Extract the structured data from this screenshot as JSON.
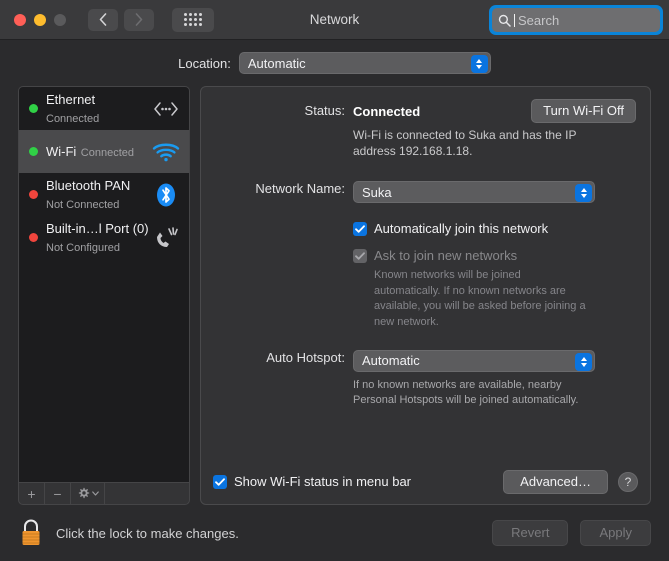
{
  "window": {
    "title": "Network",
    "traffic_lights": [
      "close",
      "minimize",
      "zoom"
    ]
  },
  "toolbar": {
    "back_label": "‹",
    "forward_label": "›",
    "grid_name": "show-all-preferences",
    "search": {
      "placeholder": "Search",
      "value": "",
      "focused": true
    }
  },
  "location": {
    "label": "Location:",
    "value": "Automatic"
  },
  "sidebar": {
    "interfaces": [
      {
        "name": "Ethernet",
        "status": "Connected",
        "dot": "green",
        "icon": "ethernet-icon",
        "selected": false
      },
      {
        "name": "Wi-Fi",
        "status": "Connected",
        "dot": "green",
        "icon": "wifi-icon",
        "selected": true
      },
      {
        "name": "Bluetooth PAN",
        "status": "Not Connected",
        "dot": "red",
        "icon": "bluetooth-icon",
        "selected": false
      },
      {
        "name": "Built-in…l Port (0)",
        "status": "Not Configured",
        "dot": "red",
        "icon": "modem-icon",
        "selected": false
      }
    ],
    "toolbar": {
      "add_label": "+",
      "remove_label": "−",
      "gear_label": "gear-icon"
    }
  },
  "main": {
    "status": {
      "label": "Status:",
      "value": "Connected",
      "description": "Wi-Fi is connected to Suka and has the IP address 192.168.1.18.",
      "toggle_button": "Turn Wi-Fi Off"
    },
    "network_name": {
      "label": "Network Name:",
      "value": "Suka"
    },
    "auto_join": {
      "label": "Automatically join this network",
      "checked": true,
      "enabled": true
    },
    "ask_join": {
      "label": "Ask to join new networks",
      "checked": true,
      "enabled": false,
      "note": "Known networks will be joined automatically. If no known networks are available, you will be asked before joining a new network."
    },
    "auto_hotspot": {
      "label": "Auto Hotspot:",
      "value": "Automatic",
      "note": "If no known networks are available, nearby Personal Hotspots will be joined automatically."
    },
    "menu_bar": {
      "label": "Show Wi-Fi status in menu bar",
      "checked": true
    },
    "advanced_button": "Advanced…",
    "help_button": "?"
  },
  "bottom": {
    "lock_text": "Click the lock to make changes.",
    "lock_state": "locked",
    "revert_button": "Revert",
    "apply_button": "Apply",
    "buttons_enabled": false
  },
  "colors": {
    "accent_blue": "#0a74e0",
    "focus_ring": "#0a84d8",
    "status_green": "#30d146",
    "status_red": "#f0453d",
    "wifi_icon_blue": "#1a9bf0",
    "lock_orange": "#f0952e",
    "window_bg": "#2b2b2d",
    "panel_bg": "#333335",
    "sidebar_bg": "#1c1c1e",
    "selected_row": "#4a4a4c"
  }
}
